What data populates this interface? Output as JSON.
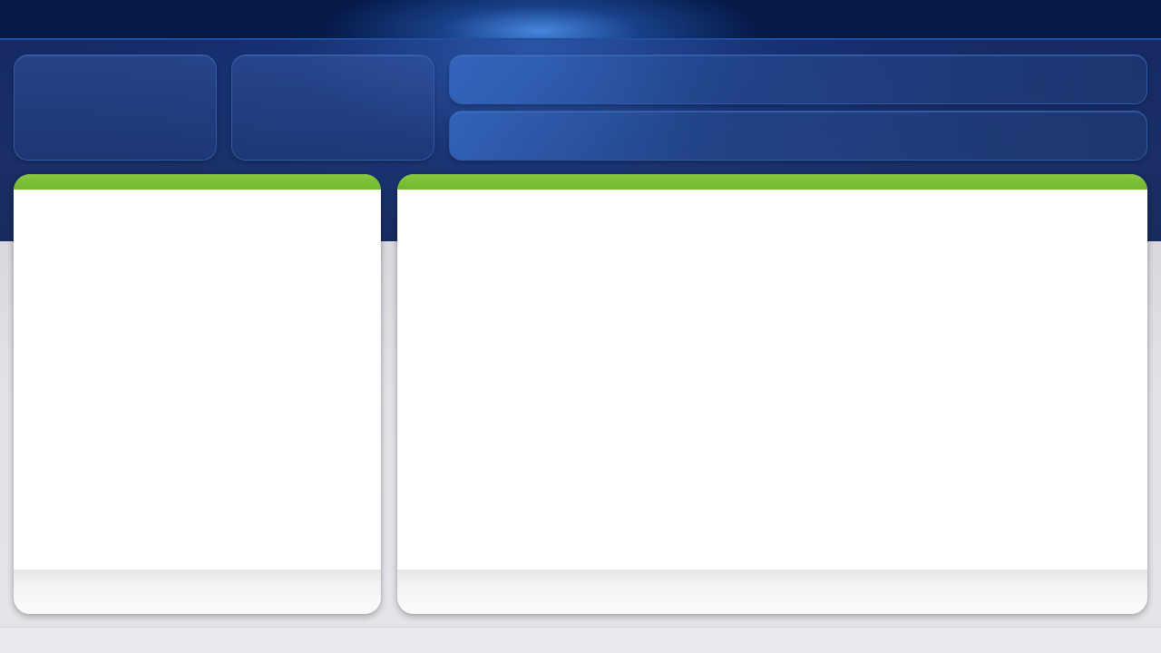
{
  "topbar": {},
  "hero": {
    "card_1": {},
    "card_2": {},
    "banner_top": {},
    "banner_bottom": {}
  },
  "panels": {
    "left": {},
    "right": {}
  },
  "colors": {
    "navy": "#061a48",
    "hero_blue": "#1a2f66",
    "accent_green": "#7cc038",
    "panel_white": "#ffffff",
    "page_gray": "#e2e2e8"
  }
}
